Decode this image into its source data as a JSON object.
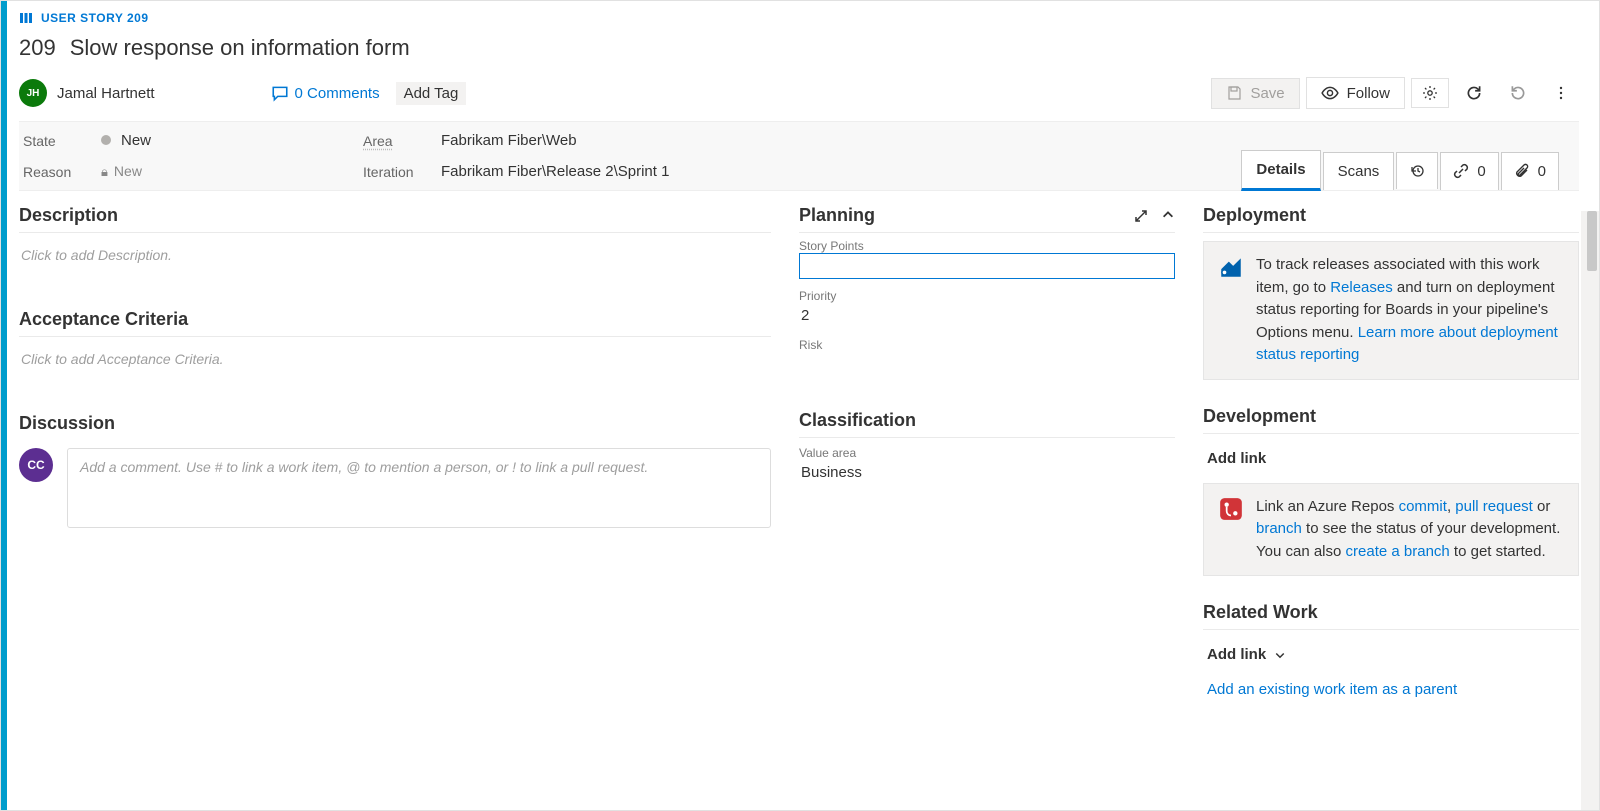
{
  "header": {
    "type_label": "USER STORY 209",
    "id": "209",
    "title": "Slow response on information form"
  },
  "assignee": {
    "initials": "JH",
    "name": "Jamal Hartnett"
  },
  "discussion_avatar": "CC",
  "comments": {
    "count_label": "0 Comments"
  },
  "add_tag": "Add Tag",
  "toolbar": {
    "save": "Save",
    "follow": "Follow"
  },
  "meta": {
    "state_label": "State",
    "state_value": "New",
    "reason_label": "Reason",
    "reason_value": "New",
    "area_label": "Area",
    "area_value": "Fabrikam Fiber\\Web",
    "iteration_label": "Iteration",
    "iteration_value": "Fabrikam Fiber\\Release 2\\Sprint 1"
  },
  "tabs": {
    "details": "Details",
    "scans": "Scans",
    "links_count": "0",
    "attach_count": "0"
  },
  "left": {
    "description_h": "Description",
    "description_ph": "Click to add Description.",
    "acceptance_h": "Acceptance Criteria",
    "acceptance_ph": "Click to add Acceptance Criteria.",
    "discussion_h": "Discussion",
    "discussion_ph": "Add a comment. Use # to link a work item, @ to mention a person, or ! to link a pull request."
  },
  "mid": {
    "planning_h": "Planning",
    "story_points_label": "Story Points",
    "story_points_value": "",
    "priority_label": "Priority",
    "priority_value": "2",
    "risk_label": "Risk",
    "classification_h": "Classification",
    "value_area_label": "Value area",
    "value_area_value": "Business"
  },
  "right": {
    "deployment_h": "Deployment",
    "deploy_pre": "To track releases associated with this work item, go to ",
    "deploy_releases": "Releases",
    "deploy_mid": " and turn on deployment status reporting for Boards in your pipeline's Options menu. ",
    "deploy_learn": "Learn more about deployment status reporting",
    "development_h": "Development",
    "dev_addlink": "Add link",
    "dev_pre": "Link an Azure Repos ",
    "dev_commit": "commit",
    "dev_pr": "pull request",
    "dev_or": " or ",
    "dev_branch": "branch",
    "dev_mid": " to see the status of your development. You can also ",
    "dev_create": "create a branch",
    "dev_post": " to get started.",
    "related_h": "Related Work",
    "related_addlink": "Add link",
    "related_existing": "Add an existing work item as a parent"
  }
}
